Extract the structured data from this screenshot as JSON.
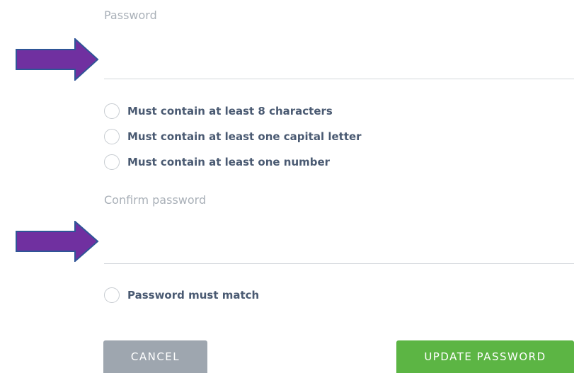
{
  "password": {
    "label": "Password",
    "value": ""
  },
  "requirements": [
    {
      "text": "Must contain at least 8 characters"
    },
    {
      "text": "Must contain at least one capital letter"
    },
    {
      "text": "Must contain at least one number"
    }
  ],
  "confirm": {
    "label": "Confirm password",
    "value": "",
    "rule": "Password must match"
  },
  "buttons": {
    "cancel_label": "CANCEL",
    "update_label": "UPDATE PASSWORD"
  },
  "colors": {
    "arrow": "#7030a0",
    "arrow_outline": "#2f5597",
    "update_button": "#5cb544",
    "cancel_button": "#9ea6af",
    "rule_text": "#4a5a72",
    "label_text": "#a9b0b8"
  }
}
